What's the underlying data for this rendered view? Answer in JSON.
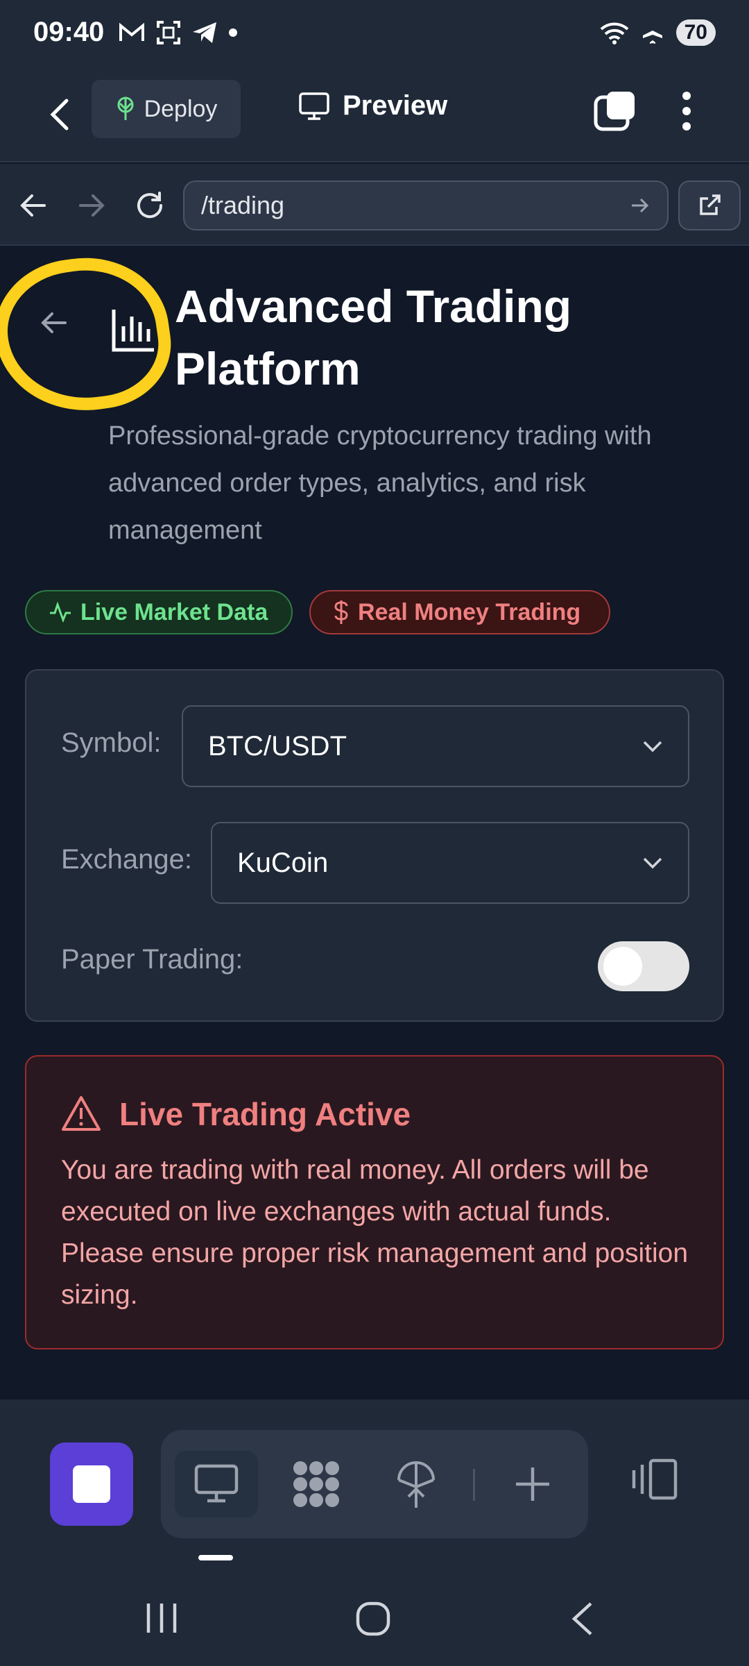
{
  "status_bar": {
    "time": "09:40",
    "battery": "70"
  },
  "top_bar": {
    "deploy_label": "Deploy",
    "preview_label": "Preview"
  },
  "browser": {
    "url": "/trading"
  },
  "page": {
    "title": "Advanced Trading Platform",
    "subtitle": "Professional-grade cryptocurrency trading with advanced order types, analytics, and risk management",
    "badges": {
      "live": "Live Market Data",
      "money": "Real Money Trading"
    },
    "symbol_label": "Symbol:",
    "symbol_value": "BTC/USDT",
    "exchange_label": "Exchange:",
    "exchange_value": "KuCoin",
    "paper_label": "Paper Trading:",
    "paper_enabled": false
  },
  "alert": {
    "title": "Live Trading Active",
    "body": "You are trading with real money. All orders will be executed on live exchanges with actual funds. Please ensure proper risk management and position sizing."
  },
  "colors": {
    "accent": "#5b3fd6",
    "annotation": "#fcd01c",
    "danger": "#f08080",
    "success": "#6ee28f"
  }
}
